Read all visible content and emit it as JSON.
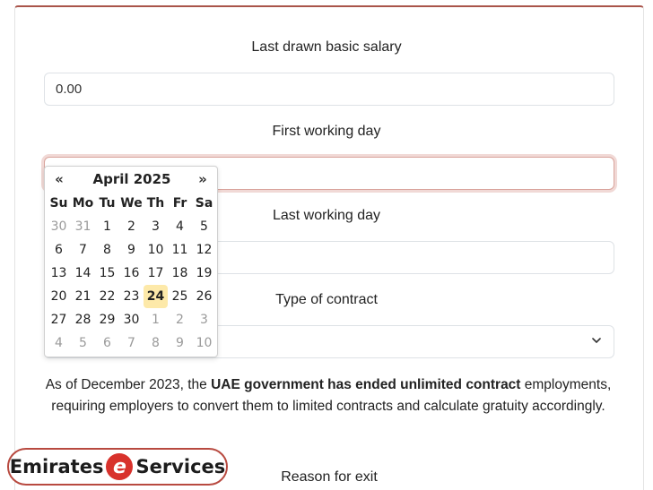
{
  "form": {
    "salary_label": "Last drawn basic salary",
    "salary_value": "0.00",
    "first_day_label": "First working day",
    "first_day_value": "",
    "last_day_label": "Last working day",
    "last_day_value": "",
    "contract_label": "Type of contract",
    "contract_value": "",
    "reason_label": "Reason for exit"
  },
  "notice": {
    "part1": "As of December 2023, the ",
    "bold": "UAE government has ended unlimited contract",
    "part2": " employments, requiring employers to convert them to limited contracts and calculate gratuity accordingly."
  },
  "datepicker": {
    "prev": "«",
    "next": "»",
    "title": "April 2025",
    "weekdays": [
      "Su",
      "Mo",
      "Tu",
      "We",
      "Th",
      "Fr",
      "Sa"
    ],
    "weeks": [
      [
        {
          "d": "30",
          "m": true
        },
        {
          "d": "31",
          "m": true
        },
        {
          "d": "1"
        },
        {
          "d": "2"
        },
        {
          "d": "3"
        },
        {
          "d": "4"
        },
        {
          "d": "5"
        }
      ],
      [
        {
          "d": "6"
        },
        {
          "d": "7"
        },
        {
          "d": "8"
        },
        {
          "d": "9"
        },
        {
          "d": "10"
        },
        {
          "d": "11"
        },
        {
          "d": "12"
        }
      ],
      [
        {
          "d": "13"
        },
        {
          "d": "14"
        },
        {
          "d": "15"
        },
        {
          "d": "16"
        },
        {
          "d": "17"
        },
        {
          "d": "18"
        },
        {
          "d": "19"
        }
      ],
      [
        {
          "d": "20"
        },
        {
          "d": "21"
        },
        {
          "d": "22"
        },
        {
          "d": "23"
        },
        {
          "d": "24",
          "today": true
        },
        {
          "d": "25"
        },
        {
          "d": "26"
        }
      ],
      [
        {
          "d": "27"
        },
        {
          "d": "28"
        },
        {
          "d": "29"
        },
        {
          "d": "30"
        },
        {
          "d": "1",
          "m": true
        },
        {
          "d": "2",
          "m": true
        },
        {
          "d": "3",
          "m": true
        }
      ],
      [
        {
          "d": "4",
          "m": true
        },
        {
          "d": "5",
          "m": true
        },
        {
          "d": "6",
          "m": true
        },
        {
          "d": "7",
          "m": true
        },
        {
          "d": "8",
          "m": true
        },
        {
          "d": "9",
          "m": true
        },
        {
          "d": "10",
          "m": true
        }
      ]
    ]
  },
  "logo": {
    "left": "Emirates",
    "mark": "e",
    "right": "Services"
  },
  "colors": {
    "accent": "#a9544a",
    "today_highlight": "#fde9a9",
    "logo_red": "#d8322c"
  }
}
